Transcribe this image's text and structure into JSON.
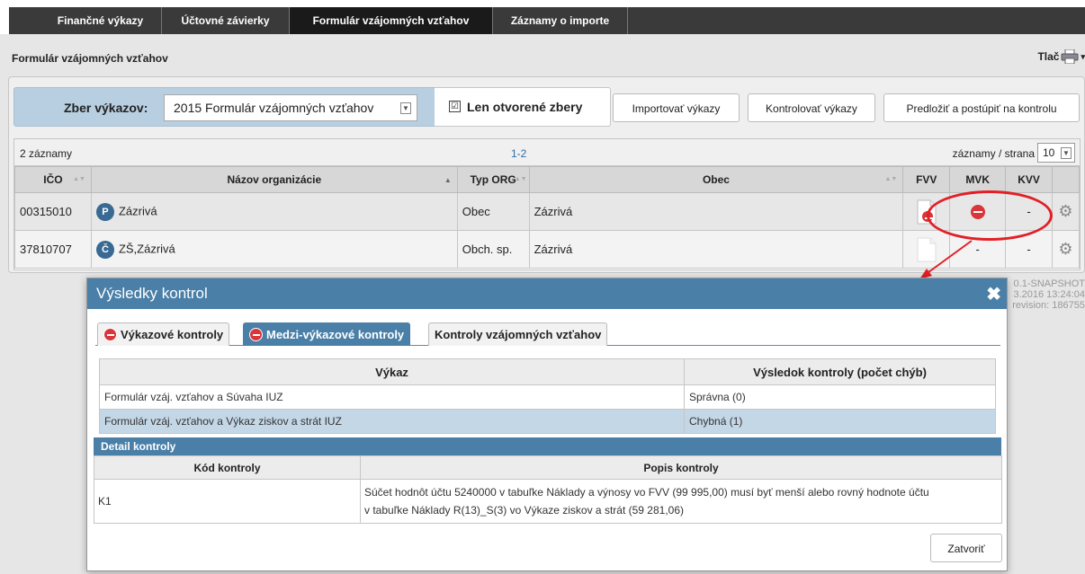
{
  "nav": {
    "tabs": [
      {
        "label": "Finančné výkazy"
      },
      {
        "label": "Účtovné závierky"
      },
      {
        "label": "Formulár vzájomných vzťahov"
      },
      {
        "label": "Záznamy o importe"
      }
    ]
  },
  "page": {
    "title": "Formulár vzájomných vzťahov",
    "print_label": "Tlač"
  },
  "filter": {
    "zber_label": "Zber výkazov:",
    "zber_value": "2015 Formulár vzájomných vzťahov",
    "checkbox_mark": "☑",
    "checkbox_label": "Len otvorené zbery"
  },
  "actions": {
    "import": "Importovať výkazy",
    "check": "Kontrolovať výkazy",
    "submit": "Predložiť a postúpiť na kontrolu"
  },
  "pager": {
    "count": "2 záznamy",
    "range": "1-2",
    "per_page_label": "záznamy / strana",
    "per_page_value": "10"
  },
  "table": {
    "headers": {
      "ico": "IČO",
      "nazov": "Názov organizácie",
      "typ": "Typ ORG",
      "obec": "Obec",
      "fvv": "FVV",
      "mvk": "MVK",
      "kvv": "KVV"
    },
    "rows": [
      {
        "ico": "00315010",
        "badge": "P",
        "nazov": "Zázrivá",
        "typ": "Obec",
        "obec": "Zázrivá",
        "kvv": "-"
      },
      {
        "ico": "37810707",
        "badge": "Č",
        "nazov": "ZŠ,Zázrivá",
        "typ": "Obch. sp.",
        "obec": "Zázrivá",
        "mvk": "-",
        "kvv": "-"
      }
    ]
  },
  "version": {
    "line1": "0.1-SNAPSHOT",
    "line2": "3.2016 13:24:04",
    "line3": "revision: 186755"
  },
  "modal": {
    "title": "Výsledky kontrol",
    "close_icon": "✖",
    "tabs": [
      {
        "label": "Výkazové kontroly"
      },
      {
        "label": "Medzi-výkazové kontroly"
      },
      {
        "label": "Kontroly vzájomných vzťahov"
      }
    ],
    "results": {
      "headers": {
        "vykaz": "Výkaz",
        "vysledok": "Výsledok kontroly (počet chýb)"
      },
      "rows": [
        {
          "vykaz": "Formulár vzáj. vzťahov a Súvaha IUZ",
          "vysledok": "Správna (0)"
        },
        {
          "vykaz": "Formulár vzáj. vzťahov a Výkaz ziskov a strát IUZ",
          "vysledok": "Chybná (1)"
        }
      ]
    },
    "detail": {
      "title": "Detail kontroly",
      "headers": {
        "kod": "Kód kontroly",
        "popis": "Popis kontroly"
      },
      "rows": [
        {
          "kod": "K1",
          "popis_line1": "Súčet hodnôt účtu 5240000 v tabuľke Náklady a výnosy vo FVV (99 995,00) musí byť menší alebo rovný hodnote účtu",
          "popis_line2": "v tabuľke Náklady R(13)_S(3) vo Výkaze ziskov a strát (59 281,06)"
        }
      ]
    },
    "close_label": "Zatvoriť"
  },
  "icons": {
    "error": "no-entry-icon",
    "document": "document-icon",
    "gear": "gear-icon",
    "print": "printer-icon"
  },
  "colors": {
    "header_blue": "#4a7fa8",
    "error_red": "#d9353a",
    "highlight_red": "#e21f26",
    "badge_blue": "#386a93"
  }
}
